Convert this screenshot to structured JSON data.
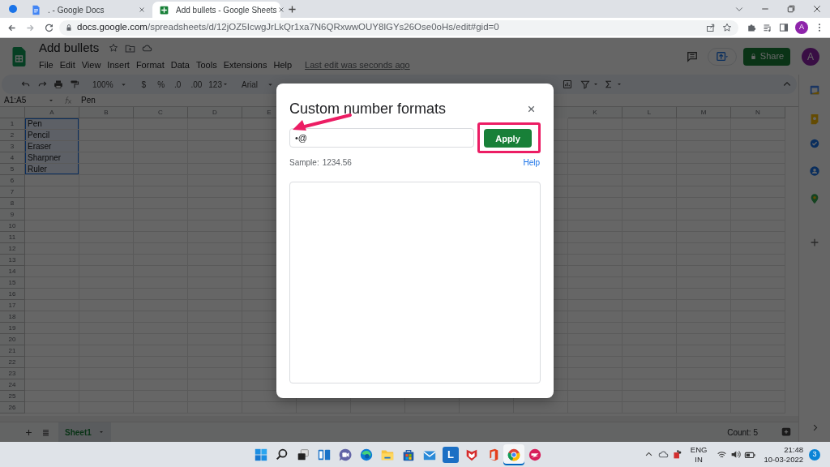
{
  "browser": {
    "tabs": [
      {
        "kind": "docs",
        "title": ". - Google Docs",
        "selected": false
      },
      {
        "kind": "sheets",
        "title": "Add bullets - Google Sheets",
        "selected": true
      }
    ],
    "url": {
      "host": "docs.google.com",
      "path": "/spreadsheets/d/12jOZ5IcwgJrLkQr1xa7N6QRxwwOUY8lGYs26Ose0oHs/edit#gid=0"
    },
    "profile_initial": "A"
  },
  "sheets": {
    "title": "Add bullets",
    "menu": [
      "File",
      "Edit",
      "View",
      "Insert",
      "Format",
      "Data",
      "Tools",
      "Extensions",
      "Help"
    ],
    "last_edit": "Last edit was seconds ago",
    "share_label": "Share",
    "avatar_initial": "A",
    "toolbar": {
      "zoom": "100%",
      "currency": "$",
      "percent": "%",
      "decrease_decimals": ".0",
      "increase_decimals": ".00",
      "more_formats": "123",
      "font": "Arial"
    },
    "name_box": "A1:A5",
    "formula": "Pen",
    "columns_left": [
      "A",
      "B",
      "C",
      "D",
      "E"
    ],
    "columns_right": [
      "K",
      "L",
      "M",
      "N"
    ],
    "row_numbers": [
      "1",
      "2",
      "3",
      "4",
      "5",
      "6",
      "7",
      "8",
      "9",
      "10",
      "11",
      "12",
      "13",
      "14",
      "15",
      "16",
      "17",
      "18",
      "19",
      "20",
      "21",
      "22",
      "23",
      "24",
      "25",
      "26"
    ],
    "column_a": [
      {
        "text": "Pen",
        "selected": true
      },
      {
        "text": "Pencil",
        "selected": true
      },
      {
        "text": "Eraser",
        "selected": true
      },
      {
        "text": "Sharpner",
        "selected": true
      },
      {
        "text": "Ruler",
        "selected": true
      }
    ],
    "sheet_tabs": [
      {
        "label": "Sheet1",
        "selected": true
      }
    ],
    "status": "Count: 5"
  },
  "dialog": {
    "title": "Custom number formats",
    "format": "•@",
    "apply_label": "Apply",
    "sample_label": "Sample:",
    "sample_value": "1234.56",
    "help_link": "Help"
  },
  "annotations": {
    "arrow": true,
    "highlight_apply": true
  },
  "taskbar": {
    "apps": [
      {
        "kind": "start",
        "selected": false
      },
      {
        "kind": "search",
        "selected": false
      },
      {
        "kind": "taskview",
        "selected": false
      },
      {
        "kind": "widgets",
        "selected": false
      },
      {
        "kind": "chat",
        "selected": false
      },
      {
        "kind": "edge",
        "selected": false
      },
      {
        "kind": "folder",
        "selected": false
      },
      {
        "kind": "store",
        "selected": false
      },
      {
        "kind": "mail",
        "selected": false
      },
      {
        "kind": "letter",
        "label": "L",
        "selected": false
      },
      {
        "kind": "shield",
        "selected": false
      },
      {
        "kind": "office",
        "selected": false
      },
      {
        "kind": "chrome",
        "selected": true
      },
      {
        "kind": "messenger",
        "selected": false
      }
    ],
    "tray": {
      "language": "ENG",
      "region": "IN",
      "time": "21:48",
      "date": "10-03-2022",
      "notifications": "3"
    }
  }
}
